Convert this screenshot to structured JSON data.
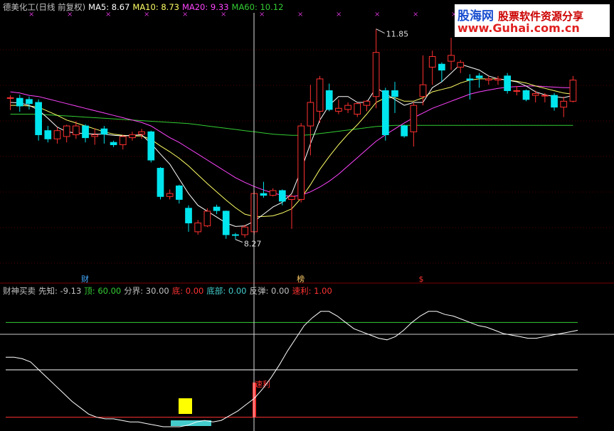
{
  "header": {
    "title": "德美化工(日线 前复权)",
    "ma": [
      {
        "label": "MA5: 8.67",
        "color": "#ffffff"
      },
      {
        "label": "MA10: 8.73",
        "color": "#ffff66"
      },
      {
        "label": "MA20: 9.33",
        "color": "#ff44ff"
      },
      {
        "label": "MA60: 10.12",
        "color": "#33cc33"
      }
    ]
  },
  "indicator_header": {
    "items": [
      {
        "label": "财神买卖",
        "color": "#c0c0c0"
      },
      {
        "label": "先知: -9.13",
        "color": "#c0c0c0"
      },
      {
        "label": "顶: 60.00",
        "color": "#33cc33"
      },
      {
        "label": "分界: 30.00",
        "color": "#c0c0c0"
      },
      {
        "label": "底: 0.00",
        "color": "#ff3333"
      },
      {
        "label": "底部: 0.00",
        "color": "#44cccc"
      },
      {
        "label": "反弹: 0.00",
        "color": "#c0c0c0"
      },
      {
        "label": "速利: 1.00",
        "color": "#ff3333"
      }
    ]
  },
  "logo": {
    "line1": "股海网",
    "line1b": "股票软件资源分享",
    "line2": "www.Guhai.com.cn"
  },
  "chart_data": [
    {
      "type": "candlestick",
      "price_range": [
        7.6,
        12.1
      ],
      "annotations": {
        "high_label": "11.85",
        "low_label": "8.27",
        "markers": [
          "财",
          "榜",
          "$"
        ]
      },
      "colors": {
        "up": "#ff3030",
        "down": "#00e5ee",
        "ma5": "#ffffff",
        "ma10": "#ffff66",
        "ma20": "#ff44ff",
        "ma60": "#33cc33"
      },
      "ohlc": [
        [
          10.67,
          10.72,
          10.47,
          10.68
        ],
        [
          10.67,
          10.73,
          10.44,
          10.54
        ],
        [
          10.65,
          10.7,
          10.48,
          10.58
        ],
        [
          10.6,
          10.65,
          9.95,
          10.05
        ],
        [
          10.12,
          10.2,
          9.92,
          9.98
        ],
        [
          9.98,
          10.18,
          9.9,
          10.12
        ],
        [
          10.02,
          10.22,
          9.92,
          10.2
        ],
        [
          10.05,
          10.28,
          9.98,
          10.2
        ],
        [
          10.2,
          10.23,
          9.92,
          10.0
        ],
        [
          10.02,
          10.16,
          9.88,
          10.05
        ],
        [
          10.15,
          10.2,
          9.9,
          10.06
        ],
        [
          9.92,
          9.95,
          9.84,
          9.88
        ],
        [
          9.88,
          10.05,
          9.8,
          10.02
        ],
        [
          10.0,
          10.1,
          9.95,
          10.05
        ],
        [
          10.06,
          10.15,
          9.98,
          10.1
        ],
        [
          10.1,
          10.12,
          9.58,
          9.62
        ],
        [
          9.48,
          9.5,
          8.95,
          9.0
        ],
        [
          9.0,
          9.12,
          8.95,
          9.05
        ],
        [
          9.18,
          9.2,
          8.88,
          8.95
        ],
        [
          8.8,
          8.85,
          8.4,
          8.55
        ],
        [
          8.4,
          8.6,
          8.35,
          8.55
        ],
        [
          8.5,
          8.8,
          8.48,
          8.75
        ],
        [
          8.82,
          8.86,
          8.7,
          8.76
        ],
        [
          8.75,
          8.76,
          8.28,
          8.35
        ],
        [
          8.35,
          8.38,
          8.27,
          8.34
        ],
        [
          8.35,
          8.52,
          8.3,
          8.48
        ],
        [
          8.4,
          9.1,
          8.35,
          9.05
        ],
        [
          9.05,
          9.25,
          8.98,
          9.02
        ],
        [
          9.02,
          9.14,
          9.0,
          9.1
        ],
        [
          9.1,
          9.12,
          8.85,
          8.92
        ],
        [
          8.95,
          9.03,
          8.45,
          9.0
        ],
        [
          8.95,
          10.25,
          8.9,
          10.2
        ],
        [
          10.2,
          10.9,
          9.7,
          10.6
        ],
        [
          10.45,
          11.05,
          10.25,
          11.0
        ],
        [
          10.8,
          10.92,
          10.45,
          10.48
        ],
        [
          10.45,
          10.65,
          10.4,
          10.5
        ],
        [
          10.48,
          10.6,
          10.42,
          10.55
        ],
        [
          10.4,
          10.6,
          10.35,
          10.58
        ],
        [
          10.55,
          10.64,
          10.45,
          10.62
        ],
        [
          10.7,
          11.85,
          10.5,
          11.45
        ],
        [
          10.8,
          10.85,
          9.95,
          10.05
        ],
        [
          10.8,
          10.95,
          10.42,
          10.7
        ],
        [
          10.2,
          10.22,
          10.0,
          10.03
        ],
        [
          10.1,
          10.6,
          9.85,
          10.55
        ],
        [
          10.7,
          11.4,
          10.55,
          10.9
        ],
        [
          11.2,
          11.48,
          10.9,
          11.38
        ],
        [
          11.25,
          11.28,
          10.95,
          11.15
        ],
        [
          11.3,
          11.7,
          11.15,
          11.4
        ],
        [
          11.2,
          11.32,
          11.1,
          11.28
        ],
        [
          11.0,
          11.08,
          10.65,
          10.98
        ],
        [
          11.05,
          11.1,
          10.85,
          11.02
        ],
        [
          10.98,
          11.05,
          10.9,
          11.0
        ],
        [
          10.98,
          11.05,
          10.9,
          11.0
        ],
        [
          11.05,
          11.1,
          10.75,
          10.8
        ],
        [
          10.8,
          10.88,
          10.72,
          10.8
        ],
        [
          10.8,
          10.82,
          10.62,
          10.65
        ],
        [
          10.72,
          10.8,
          10.6,
          10.75
        ],
        [
          10.72,
          10.76,
          10.6,
          10.72
        ],
        [
          10.72,
          10.76,
          10.46,
          10.52
        ],
        [
          10.52,
          10.7,
          10.35,
          10.62
        ],
        [
          10.62,
          11.05,
          10.6,
          10.98
        ]
      ],
      "ma5": [
        10.6,
        10.59,
        10.55,
        10.47,
        10.33,
        10.18,
        10.1,
        10.08,
        10.07,
        10.06,
        10.06,
        10.04,
        10.03,
        10.04,
        10.05,
        9.9,
        9.72,
        9.55,
        9.3,
        9.05,
        8.85,
        8.75,
        8.65,
        8.55,
        8.49,
        8.5,
        8.58,
        8.7,
        8.82,
        8.9,
        9.05,
        9.45,
        9.9,
        10.3,
        10.55,
        10.7,
        10.7,
        10.6,
        10.6,
        10.85,
        10.75,
        10.65,
        10.55,
        10.6,
        10.6,
        10.85,
        10.95,
        11.1,
        11.25,
        11.2,
        11.15,
        11.05,
        11.0,
        10.98,
        10.95,
        10.88,
        10.78,
        10.73,
        10.7,
        10.68,
        10.72
      ],
      "ma10": [
        10.55,
        10.55,
        10.54,
        10.52,
        10.45,
        10.38,
        10.3,
        10.25,
        10.2,
        10.15,
        10.1,
        10.06,
        10.04,
        10.03,
        10.03,
        9.97,
        9.86,
        9.76,
        9.65,
        9.52,
        9.37,
        9.22,
        9.08,
        8.94,
        8.81,
        8.7,
        8.66,
        8.66,
        8.67,
        8.72,
        8.79,
        8.97,
        9.2,
        9.46,
        9.68,
        9.88,
        10.06,
        10.22,
        10.4,
        10.6,
        10.68,
        10.68,
        10.62,
        10.62,
        10.68,
        10.78,
        10.82,
        10.86,
        10.93,
        10.98,
        11.0,
        11.0,
        11.0,
        10.98,
        10.96,
        10.93,
        10.88,
        10.84,
        10.8,
        10.76,
        10.74
      ],
      "ma20": [
        10.78,
        10.76,
        10.72,
        10.7,
        10.66,
        10.62,
        10.58,
        10.54,
        10.5,
        10.46,
        10.42,
        10.38,
        10.34,
        10.3,
        10.26,
        10.2,
        10.1,
        10.0,
        9.92,
        9.82,
        9.72,
        9.62,
        9.52,
        9.42,
        9.32,
        9.24,
        9.17,
        9.11,
        9.06,
        9.02,
        9.0,
        9.02,
        9.08,
        9.16,
        9.26,
        9.38,
        9.52,
        9.66,
        9.8,
        9.94,
        10.05,
        10.15,
        10.25,
        10.34,
        10.42,
        10.5,
        10.56,
        10.62,
        10.68,
        10.74,
        10.78,
        10.81,
        10.84,
        10.86,
        10.87,
        10.88,
        10.88,
        10.87,
        10.86,
        10.85,
        10.85
      ],
      "ma60": [
        10.4,
        10.4,
        10.4,
        10.4,
        10.39,
        10.38,
        10.37,
        10.36,
        10.35,
        10.34,
        10.33,
        10.32,
        10.31,
        10.3,
        10.29,
        10.28,
        10.27,
        10.26,
        10.25,
        10.24,
        10.22,
        10.2,
        10.18,
        10.16,
        10.14,
        10.12,
        10.1,
        10.08,
        10.06,
        10.05,
        10.04,
        10.04,
        10.05,
        10.07,
        10.09,
        10.11,
        10.13,
        10.15,
        10.17,
        10.19,
        10.2,
        10.21,
        10.21,
        10.21,
        10.21,
        10.21,
        10.21,
        10.21,
        10.21,
        10.21,
        10.21,
        10.21,
        10.21,
        10.21,
        10.21,
        10.21,
        10.21,
        10.21,
        10.21,
        10.21,
        10.21
      ]
    },
    {
      "type": "line",
      "y_range": [
        -6,
        75
      ],
      "reference_lines": [
        {
          "label": "顶",
          "value": 60,
          "color": "#33cc33"
        },
        {
          "label": "分界",
          "value": 30,
          "color": "#ffffff"
        },
        {
          "label": "底",
          "value": 0,
          "color": "#ff3333"
        }
      ],
      "series": [
        {
          "name": "先知",
          "color": "#ffffff",
          "values": [
            38,
            38,
            37,
            35,
            30,
            25,
            20,
            15,
            10,
            6,
            2,
            0,
            -1,
            -1,
            -2,
            -3,
            -3,
            -4,
            -5,
            -6,
            -6,
            -6,
            -5,
            -3,
            -2,
            -3,
            -2,
            1,
            4,
            8,
            12,
            18,
            25,
            33,
            42,
            50,
            58,
            63,
            67,
            67,
            64,
            60,
            56,
            54,
            52,
            50,
            49,
            51,
            55,
            60,
            64,
            67,
            67,
            65,
            64,
            62,
            60,
            58,
            57,
            55,
            53,
            52,
            51,
            50,
            50,
            51,
            52,
            53,
            54,
            55
          ]
        }
      ],
      "signals": [
        {
          "name": "速利",
          "x_index": 30,
          "value": 22,
          "color": "#ff3030",
          "label": "速利"
        },
        {
          "name": "底部",
          "x_index": 20,
          "value": -6,
          "color": "#ffff00"
        },
        {
          "name": "反弹",
          "x_index": 20,
          "value": -6,
          "color": "#44cccc"
        }
      ]
    }
  ]
}
